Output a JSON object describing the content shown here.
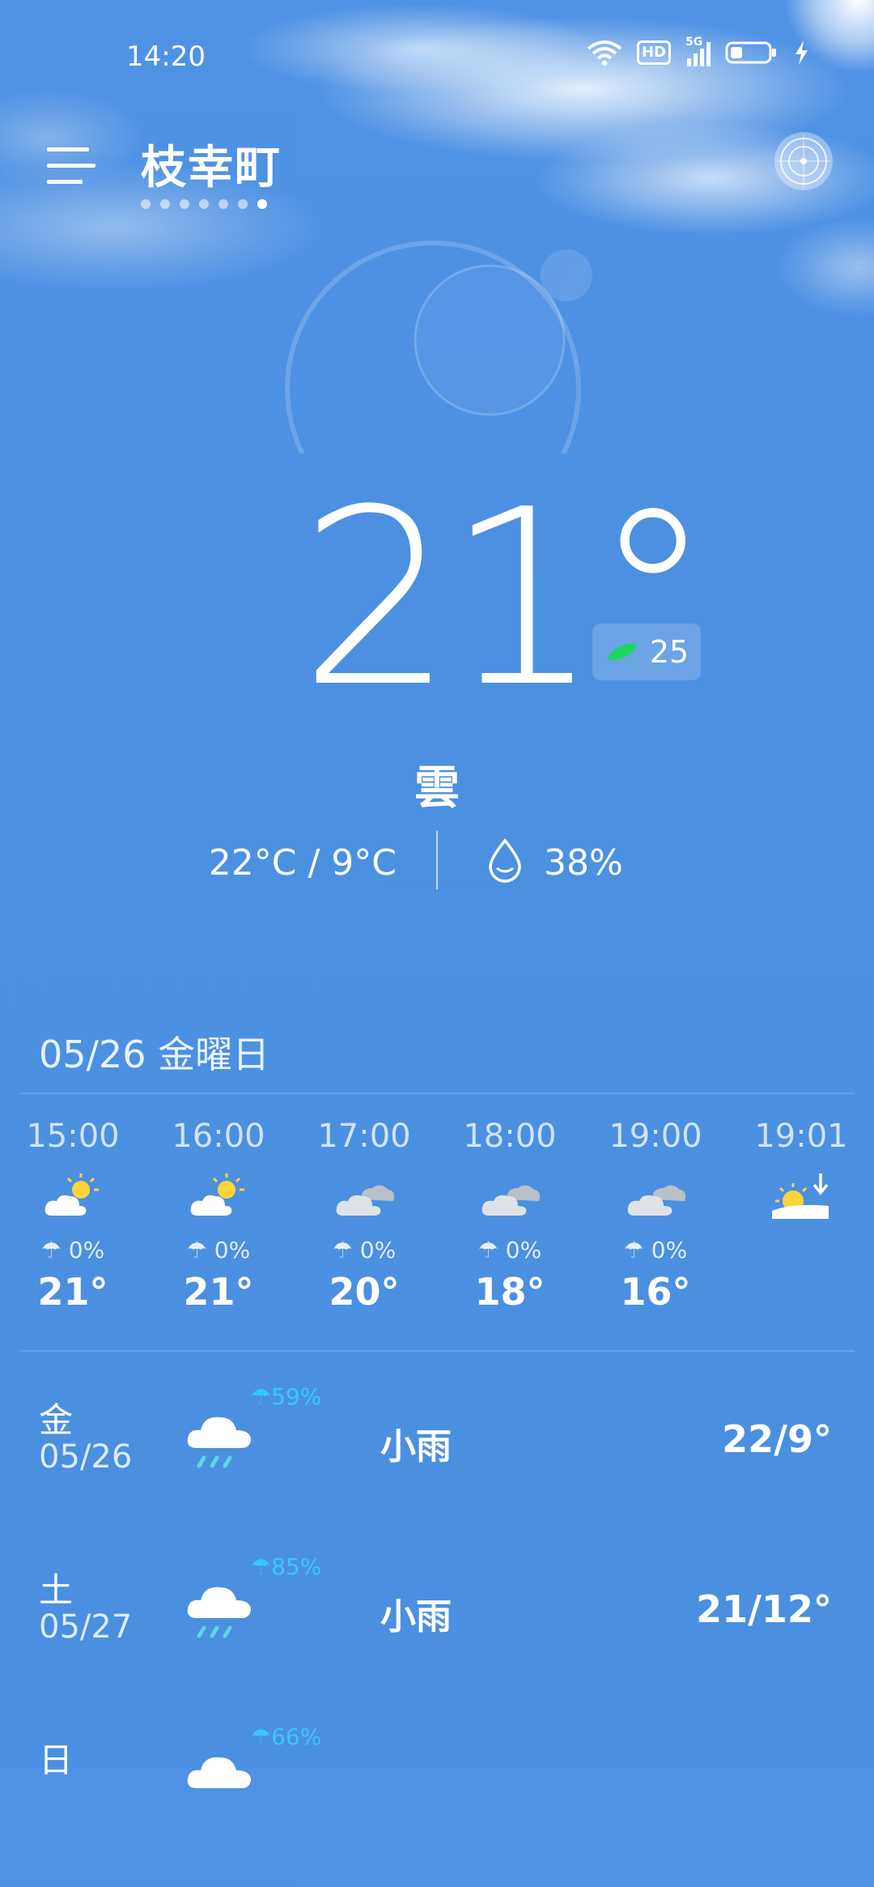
{
  "status": {
    "time": "14:20",
    "hd_badge": "HD",
    "network": "5G"
  },
  "header": {
    "city": "枝幸町",
    "page_count": 7,
    "active_page": 6
  },
  "current": {
    "temperature": "21°",
    "aqi": "25",
    "condition": "雲",
    "hi_lo": "22°C / 9°C",
    "humidity": "38%"
  },
  "date_header": "05/26 金曜日",
  "hourly": [
    {
      "time": "15:00",
      "icon": "partly-cloudy-icon",
      "rain": "0%",
      "temp": "21°"
    },
    {
      "time": "16:00",
      "icon": "partly-cloudy-icon",
      "rain": "0%",
      "temp": "21°"
    },
    {
      "time": "17:00",
      "icon": "cloudy-icon",
      "rain": "0%",
      "temp": "20°"
    },
    {
      "time": "18:00",
      "icon": "cloudy-icon",
      "rain": "0%",
      "temp": "18°"
    },
    {
      "time": "19:00",
      "icon": "cloudy-icon",
      "rain": "0%",
      "temp": "16°"
    },
    {
      "time": "19:01",
      "icon": "sunset-icon",
      "rain": "",
      "temp": ""
    }
  ],
  "daily": [
    {
      "day": "金",
      "date": "05/26",
      "pop": "59%",
      "condition": "小雨",
      "temps": "22/9°",
      "icon": "light-rain-icon"
    },
    {
      "day": "土",
      "date": "05/27",
      "pop": "85%",
      "condition": "小雨",
      "temps": "21/12°",
      "icon": "light-rain-icon"
    },
    {
      "day": "日",
      "date": "",
      "pop": "66%",
      "condition": "",
      "temps": "",
      "icon": "light-rain-icon"
    }
  ],
  "colors": {
    "background": "#4c90e1",
    "rain_accent": "#38c7ff",
    "sun": "#ffd43b",
    "aqi_leaf": "#1ed760"
  }
}
